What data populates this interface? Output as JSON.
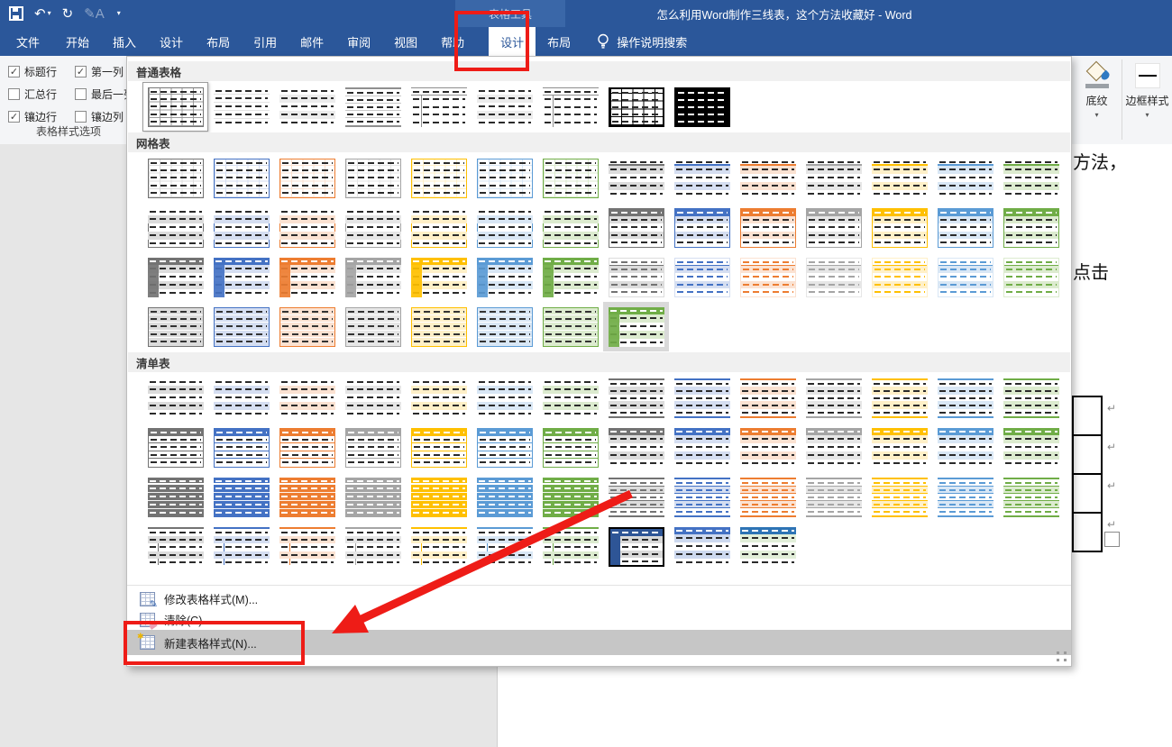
{
  "app": {
    "accent_color": "#2b579a",
    "annotation_color": "#ee1c17",
    "highlight_row_color": "#c6c6c6"
  },
  "title_bar": {
    "title": "怎么利用Word制作三线表，这个方法收藏好 - Word",
    "context_group": "表格工具",
    "qat_icons": [
      "save-icon",
      "undo-icon",
      "redo-icon",
      "format-icon",
      "customize-qat-icon"
    ]
  },
  "tab_bar": {
    "file_tab": "文件",
    "tabs": [
      "开始",
      "插入",
      "设计",
      "布局",
      "引用",
      "邮件",
      "审阅",
      "视图",
      "帮助"
    ],
    "contextual_tabs": [
      {
        "label": "设计",
        "active": true
      },
      {
        "label": "布局",
        "active": false
      }
    ],
    "tell_me": "操作说明搜索"
  },
  "ribbon": {
    "style_options": {
      "group_label": "表格样式选项",
      "checkboxes": [
        {
          "label": "标题行",
          "checked": true
        },
        {
          "label": "第一列",
          "checked": true
        },
        {
          "label": "汇总行",
          "checked": false
        },
        {
          "label": "最后一列",
          "checked": false
        },
        {
          "label": "镶边行",
          "checked": true
        },
        {
          "label": "镶边列",
          "checked": false
        }
      ]
    },
    "shading_label": "底纹",
    "border_styles_label": "边框样式"
  },
  "gallery": {
    "sections": [
      {
        "title": "普通表格",
        "rows": [
          [
            "tg:k:sel",
            "p1:k",
            "p2:k",
            "p3:k",
            "p4:k",
            "p2:k",
            "p4:k",
            "g8:k",
            "g9:k"
          ]
        ]
      },
      {
        "title": "网格表",
        "rows": [
          [
            "gl:k",
            "gl:b",
            "gl:o",
            "gl:g",
            "gl:y",
            "gl:lb",
            "gl:gr",
            "g2:k",
            "g2:b",
            "g2:o",
            "g2:g",
            "g2:y",
            "g2:lb",
            "g2:gr"
          ],
          [
            "gb:k",
            "gb:b",
            "gb:o",
            "gb:g",
            "gb:y",
            "gb:lb",
            "gb:gr",
            "gh:k",
            "gh:b",
            "gh:o",
            "gh:g",
            "gh:y",
            "gh:lb",
            "gh:gr"
          ],
          [
            "gd:k",
            "gd:b",
            "gd:o",
            "gd:g",
            "gd:y",
            "gd:lb",
            "gd:gr",
            "gc:k",
            "gc:b",
            "gc:o",
            "gc:g",
            "gc:y",
            "gc:lb",
            "gc:gr"
          ],
          [
            "gc2:k",
            "gc2:b",
            "gc2:o",
            "gc2:g",
            "gc2:y",
            "gc2:lb",
            "gc2:gr",
            "gd:gr:cur"
          ]
        ]
      },
      {
        "title": "清单表",
        "rows": [
          [
            "ll:k",
            "ll:b",
            "ll:o",
            "ll:g",
            "ll:y",
            "ll:lb",
            "ll:gr",
            "l2:k",
            "l2:b",
            "l2:o",
            "l2:g",
            "l2:y",
            "l2:lb",
            "l2:gr"
          ],
          [
            "l3:k",
            "l3:b",
            "l3:o",
            "l3:g",
            "l3:y",
            "l3:lb",
            "l3:gr",
            "l4:k",
            "l4:b",
            "l4:o",
            "l4:g",
            "l4:y",
            "l4:lb",
            "l4:gr"
          ],
          [
            "l5:k",
            "l5:b",
            "l5:o",
            "l5:g",
            "l5:y",
            "l5:lb",
            "l5:gr",
            "l6:k",
            "l6:b",
            "l6:o",
            "l6:g",
            "l6:y",
            "l6:lb",
            "l6:gr"
          ],
          [
            "l7:k",
            "l7:b",
            "l7:o",
            "l7:g",
            "l7:y",
            "l7:lb",
            "l7:gr",
            "cst1:b",
            "cst2:b",
            "cst3:b"
          ]
        ]
      }
    ],
    "accent_colors": {
      "k": "#737373",
      "b": "#4472c4",
      "o": "#ed7d31",
      "g": "#a5a5a5",
      "y": "#ffc000",
      "lb": "#5b9bd5",
      "gr": "#70ad47"
    },
    "menu": [
      {
        "label": "修改表格样式(M)...",
        "icon": "modify-table-style-icon",
        "highlighted": false
      },
      {
        "label": "清除(C)",
        "icon": "clear-table-style-icon",
        "highlighted": false
      },
      {
        "label": "新建表格样式(N)...",
        "icon": "new-table-style-icon",
        "highlighted": true
      }
    ]
  },
  "document": {
    "fragments": [
      "方法，",
      "点击"
    ],
    "table_visible_rows": 4,
    "pilcrow": "↵"
  }
}
